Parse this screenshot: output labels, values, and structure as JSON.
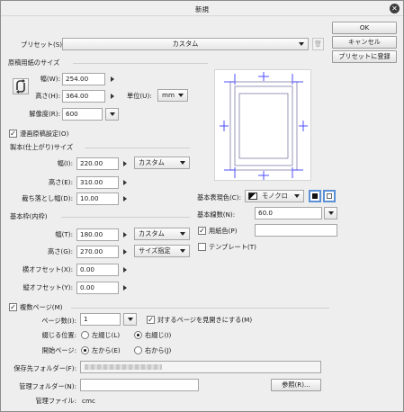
{
  "window": {
    "title": "新規",
    "close_glyph": "✕"
  },
  "buttons": {
    "ok": "OK",
    "cancel": "キャンセル",
    "register": "プリセットに登録",
    "browse": "参照(R)..."
  },
  "preset": {
    "label": "プリセット(S):",
    "value": "カスタム",
    "trash_glyph": "🗑"
  },
  "original_size": {
    "heading": "原稿用紙のサイズ",
    "width_label": "幅(W):",
    "width": "254.00",
    "height_label": "高さ(H):",
    "height": "364.00",
    "unit_label": "単位(U):",
    "unit": "mm",
    "resolution_label": "解像度(R):",
    "resolution": "600"
  },
  "manga": {
    "checkbox_label": "漫画原稿設定(O)",
    "finish_heading": "製本(仕上がり)サイズ",
    "finish_width_label": "幅(I):",
    "finish_width": "220.00",
    "finish_preset": "カスタム",
    "finish_height_label": "高さ(E):",
    "finish_height": "310.00",
    "bleed_label": "裁ち落とし幅(D):",
    "bleed": "10.00",
    "base_heading": "基本枠(内枠)",
    "base_width_label": "幅(T):",
    "base_width": "180.00",
    "base_preset": "カスタム",
    "base_height_label": "高さ(G):",
    "base_height": "270.00",
    "base_size_mode": "サイズ指定",
    "x_offset_label": "横オフセット(X):",
    "x_offset": "0.00",
    "y_offset_label": "縦オフセット(Y):",
    "y_offset": "0.00"
  },
  "render": {
    "color_label": "基本表現色(C):",
    "color_value": "モノクロ",
    "lines_label": "基本線数(N):",
    "lines_value": "60.0",
    "paper_color_label": "用紙色(P)",
    "template_label": "テンプレート(T)"
  },
  "multi_page": {
    "checkbox_label": "複数ページ(M)",
    "pages_label": "ページ数(I):",
    "pages": "1",
    "spread_label": "対するページを見開きにする(M)",
    "binding_label": "綴じる位置:",
    "binding_left": "左綴じ(L)",
    "binding_right": "右綴じ(I)",
    "start_label": "開始ページ:",
    "start_left": "左から(E)",
    "start_right": "右から(J)"
  },
  "folders": {
    "save_label": "保存先フォルダー(F):",
    "manage_label": "管理フォルダー(N):",
    "manage_file_label": "管理ファイル:",
    "manage_file": "cmc"
  }
}
